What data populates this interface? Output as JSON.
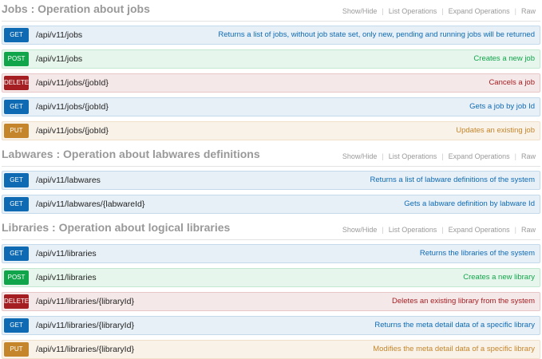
{
  "links": {
    "show_hide": "Show/Hide",
    "list_operations": "List Operations",
    "expand_operations": "Expand Operations",
    "raw": "Raw"
  },
  "colors": {
    "get": "#0f6ab4",
    "post": "#10a54a",
    "delete": "#a41e22",
    "put": "#c5862b"
  },
  "sections": [
    {
      "title": "Jobs : Operation about jobs",
      "operations": [
        {
          "method": "GET",
          "path": "/api/v11/jobs",
          "summary": "Returns a list of jobs, without job state set, only new, pending and running jobs will be returned"
        },
        {
          "method": "POST",
          "path": "/api/v11/jobs",
          "summary": "Creates a new job"
        },
        {
          "method": "DELETE",
          "path": "/api/v11/jobs/{jobId}",
          "summary": "Cancels a job"
        },
        {
          "method": "GET",
          "path": "/api/v11/jobs/{jobId}",
          "summary": "Gets a job by job Id"
        },
        {
          "method": "PUT",
          "path": "/api/v11/jobs/{jobId}",
          "summary": "Updates an existing job"
        }
      ]
    },
    {
      "title": "Labwares : Operation about labwares definitions",
      "operations": [
        {
          "method": "GET",
          "path": "/api/v11/labwares",
          "summary": "Returns a list of labware definitions of the system"
        },
        {
          "method": "GET",
          "path": "/api/v11/labwares/{labwareId}",
          "summary": "Gets a labware definition by labware Id"
        }
      ]
    },
    {
      "title": "Libraries : Operation about logical libraries",
      "operations": [
        {
          "method": "GET",
          "path": "/api/v11/libraries",
          "summary": "Returns the libraries of the system"
        },
        {
          "method": "POST",
          "path": "/api/v11/libraries",
          "summary": "Creates a new library"
        },
        {
          "method": "DELETE",
          "path": "/api/v11/libraries/{libraryId}",
          "summary": "Deletes an existing library from the system"
        },
        {
          "method": "GET",
          "path": "/api/v11/libraries/{libraryId}",
          "summary": "Returns the meta detail data of a specific library"
        },
        {
          "method": "PUT",
          "path": "/api/v11/libraries/{libraryId}",
          "summary": "Modifies the meta detail data of a specific library"
        }
      ]
    }
  ]
}
